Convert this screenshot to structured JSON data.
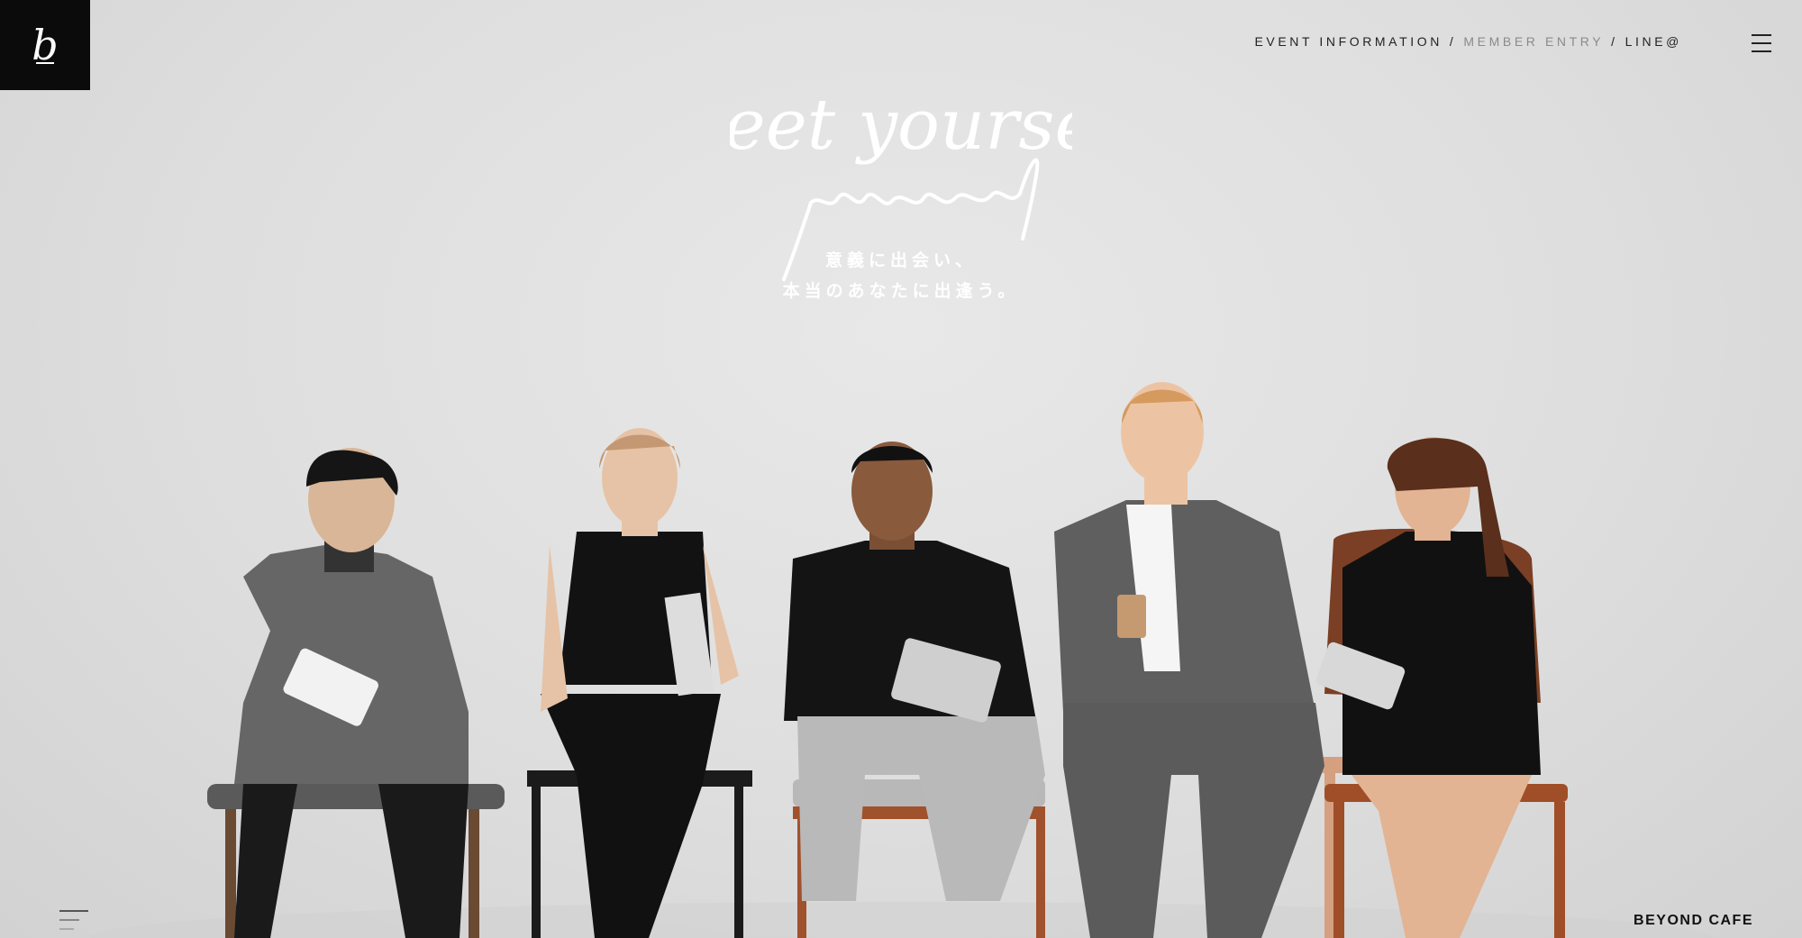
{
  "logo": {
    "letter": "b"
  },
  "nav": {
    "items": [
      {
        "label": "EVENT INFORMATION"
      },
      {
        "label": "MEMBER ENTRY"
      },
      {
        "label": "LINE@"
      }
    ],
    "separator": "/"
  },
  "hero": {
    "script_title": "meet yourself",
    "tagline_line1": "意義に出会い、",
    "tagline_line2": "本当のあなたに出逢う。"
  },
  "footer": {
    "brand": "BEYOND CAFE"
  },
  "colors": {
    "background": "#dedede",
    "logo_bg": "#0b0b0b",
    "nav_text": "#222222",
    "nav_muted": "#8a8a8a",
    "tagline": "#ffffff"
  }
}
